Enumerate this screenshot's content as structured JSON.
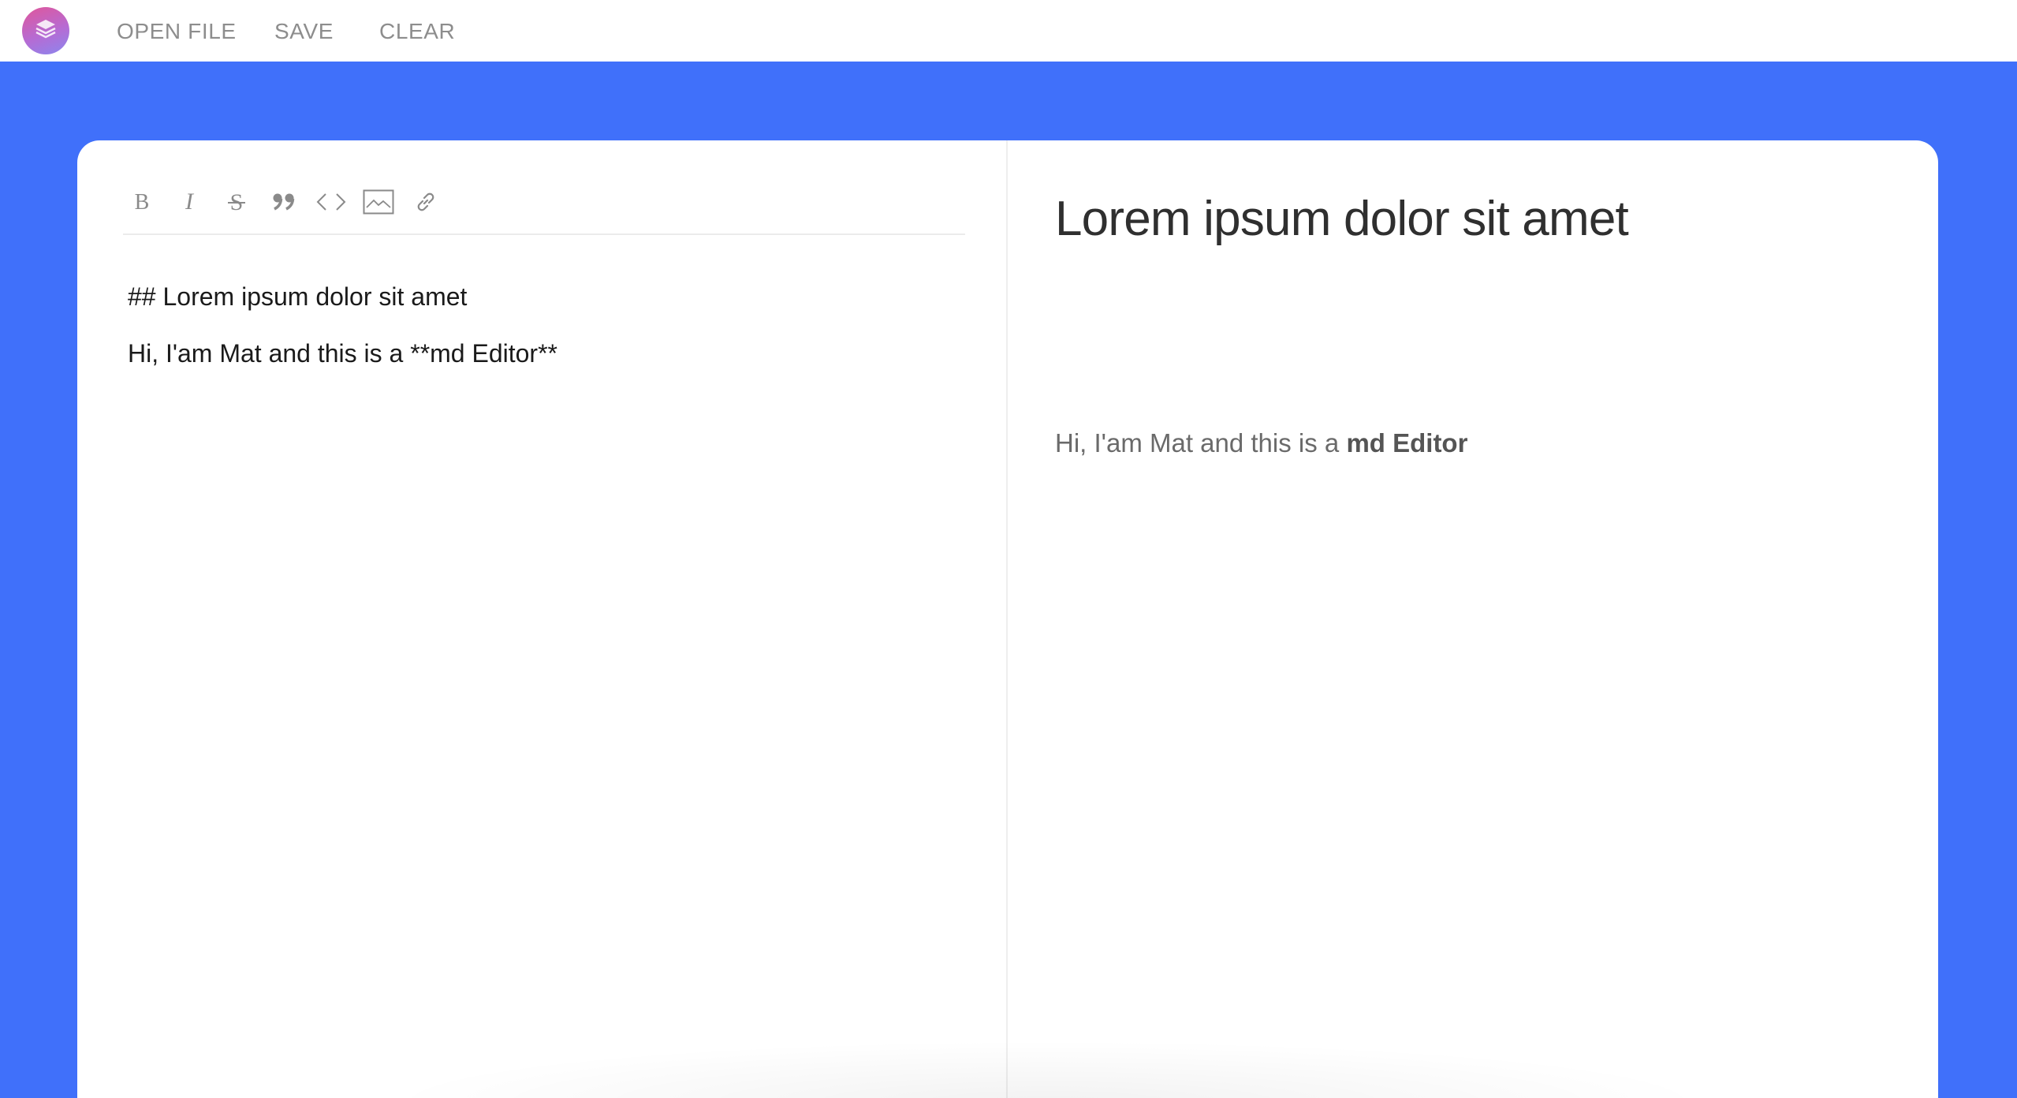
{
  "topbar": {
    "logo_icon": "layers-stack-icon",
    "menu": [
      {
        "label": "OPEN FILE"
      },
      {
        "label": "SAVE"
      },
      {
        "label": "CLEAR"
      }
    ]
  },
  "colors": {
    "background_blue": "#4070fa",
    "logo_gradient": [
      "#e0569a",
      "#8b86ee"
    ],
    "menu_text": "#8d8d8d"
  },
  "toolbar": {
    "tools": [
      "bold-icon",
      "italic-icon",
      "strikethrough-icon",
      "quote-icon",
      "code-icon",
      "image-icon",
      "link-icon"
    ]
  },
  "source": {
    "line1": "## Lorem ipsum dolor sit amet",
    "line2": "Hi, I'am Mat and this is a **md Editor**"
  },
  "preview": {
    "heading": "Lorem ipsum dolor sit amet",
    "para_prefix": "Hi, I'am Mat and this is a ",
    "para_bold": "md Editor"
  }
}
